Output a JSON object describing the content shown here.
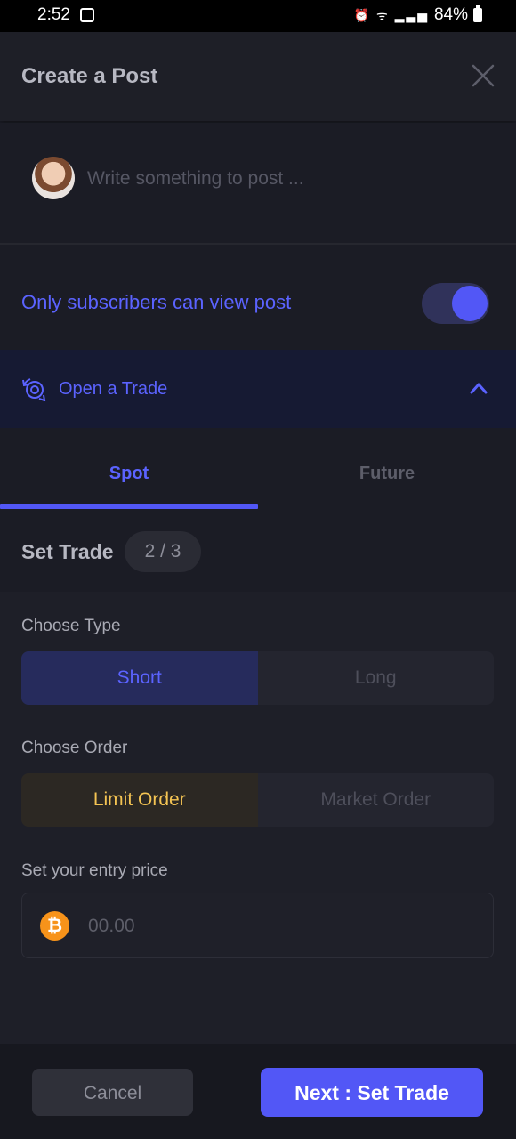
{
  "status_bar": {
    "time": "2:52",
    "battery": "84%"
  },
  "header": {
    "title": "Create a Post"
  },
  "composer": {
    "placeholder": "Write something to post ..."
  },
  "visibility": {
    "label": "Only subscribers can view post",
    "enabled": true
  },
  "trade_section": {
    "label": "Open a Trade",
    "expanded": true
  },
  "tabs": [
    {
      "label": "Spot",
      "active": true
    },
    {
      "label": "Future",
      "active": false
    }
  ],
  "step": {
    "label": "Set Trade",
    "progress": "2 / 3"
  },
  "type": {
    "label": "Choose Type",
    "options": [
      "Short",
      "Long"
    ],
    "selected": "Short"
  },
  "order": {
    "label": "Choose Order",
    "options": [
      "Limit Order",
      "Market Order"
    ],
    "selected": "Limit Order"
  },
  "entry_price": {
    "label": "Set your entry price",
    "placeholder": "00.00",
    "currency_icon": "bitcoin-icon"
  },
  "footer": {
    "cancel_label": "Cancel",
    "next_label": "Next : Set Trade"
  },
  "colors": {
    "accent": "#5257f6",
    "limit": "#f4c453",
    "bitcoin": "#f7931a"
  }
}
